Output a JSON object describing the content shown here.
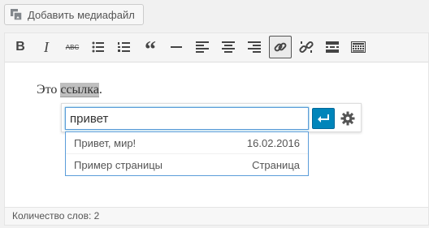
{
  "media_button": {
    "label": "Добавить медиафайл",
    "icon": "media-icon"
  },
  "toolbar": {
    "buttons": [
      {
        "name": "bold",
        "label": "B"
      },
      {
        "name": "italic",
        "label": "I"
      },
      {
        "name": "strikethrough",
        "label": "ABC"
      },
      {
        "name": "bulleted-list"
      },
      {
        "name": "numbered-list"
      },
      {
        "name": "blockquote",
        "label": "“"
      },
      {
        "name": "horizontal-line"
      },
      {
        "name": "align-left"
      },
      {
        "name": "align-center"
      },
      {
        "name": "align-right"
      },
      {
        "name": "insert-link",
        "active": true
      },
      {
        "name": "remove-link"
      },
      {
        "name": "read-more"
      },
      {
        "name": "toolbar-toggle"
      }
    ]
  },
  "content": {
    "text_before": "Это ",
    "link_text": "ссылка",
    "text_after": "."
  },
  "link_dialog": {
    "input_value": "привет",
    "apply_icon": "enter-icon",
    "settings_icon": "gear-icon"
  },
  "suggestions": [
    {
      "title": "Привет, мир!",
      "meta": "16.02.2016"
    },
    {
      "title": "Пример страницы",
      "meta": "Страница"
    }
  ],
  "status_bar": {
    "word_count": "Количество слов: 2"
  },
  "colors": {
    "accent": "#0085ba",
    "focus_border": "#5b9dd9"
  }
}
